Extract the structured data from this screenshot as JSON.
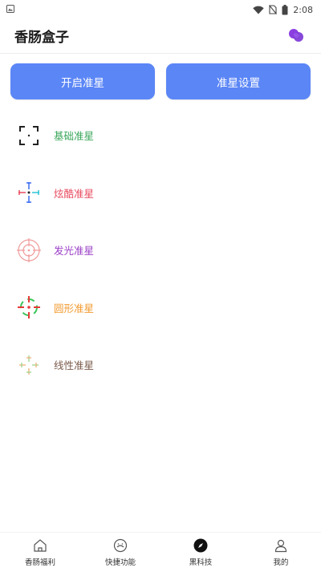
{
  "status_bar": {
    "time": "2:08"
  },
  "header": {
    "title": "香肠盒子"
  },
  "buttons": {
    "enable": "开启准星",
    "settings": "准星设置"
  },
  "crosshairs": [
    {
      "label": "基础准星",
      "color": "#3aa65a",
      "icon": "basic-crosshair-icon"
    },
    {
      "label": "炫酷准星",
      "color": "#e84a5f",
      "icon": "cool-crosshair-icon"
    },
    {
      "label": "发光准星",
      "color": "#9b3fc7",
      "icon": "glow-crosshair-icon"
    },
    {
      "label": "圆形准星",
      "color": "#f29a2e",
      "icon": "circle-crosshair-icon"
    },
    {
      "label": "线性准星",
      "color": "#7a5a4a",
      "icon": "linear-crosshair-icon"
    }
  ],
  "nav": [
    {
      "label": "香肠福利",
      "icon": "home-icon"
    },
    {
      "label": "快捷功能",
      "icon": "gamepad-icon"
    },
    {
      "label": "黑科技",
      "icon": "compass-icon",
      "active": true
    },
    {
      "label": "我的",
      "icon": "user-icon"
    }
  ],
  "colors": {
    "accent": "#5b86f6",
    "header_icon": "#8a3ee0"
  }
}
